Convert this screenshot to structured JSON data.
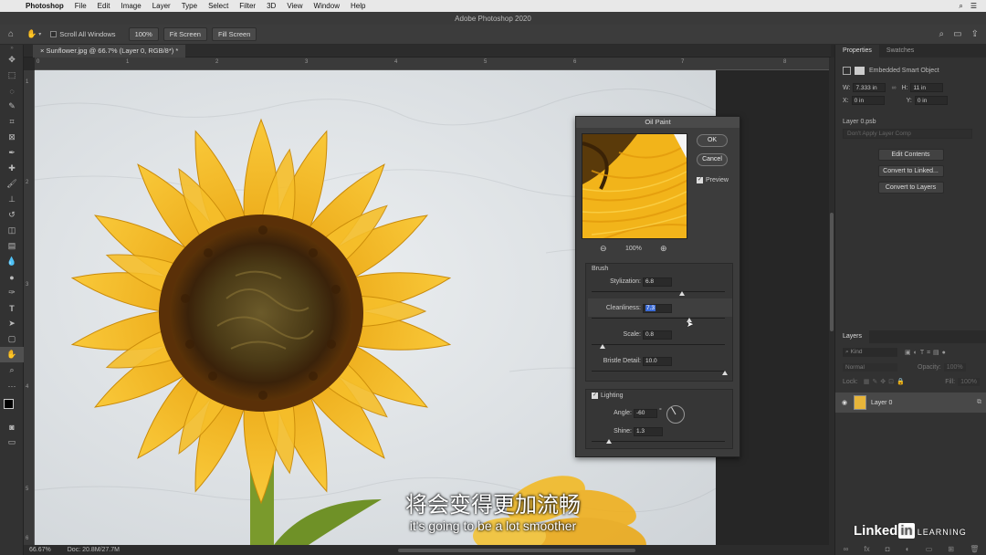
{
  "menubar": {
    "apple": "",
    "app": "Photoshop",
    "items": [
      "File",
      "Edit",
      "Image",
      "Layer",
      "Type",
      "Select",
      "Filter",
      "3D",
      "View",
      "Window",
      "Help"
    ]
  },
  "window": {
    "title": "Adobe Photoshop 2020"
  },
  "options": {
    "scroll_all": "Scroll All Windows",
    "zoom_btn": "100%",
    "fit_btn": "Fit Screen",
    "fill_btn": "Fill Screen"
  },
  "document": {
    "tab": "Sunflower.jpg @ 66.7% (Layer 0, RGB/8*) *",
    "status_zoom": "66.67%",
    "status_doc": "Doc: 20.8M/27.7M"
  },
  "ruler": {
    "h": [
      "0",
      "1",
      "2",
      "3",
      "4",
      "5",
      "6",
      "7",
      "8"
    ],
    "v": [
      "1",
      "2",
      "3",
      "4",
      "5",
      "6"
    ]
  },
  "dialog": {
    "title": "Oil Paint",
    "ok": "OK",
    "cancel": "Cancel",
    "preview": "Preview",
    "zoom": "100%",
    "brush": "Brush",
    "stylization_label": "Stylization:",
    "stylization": "6.8",
    "cleanliness_label": "Cleanliness:",
    "cleanliness": "7.3",
    "scale_label": "Scale:",
    "scale": "0.8",
    "bristle_label": "Bristle Detail:",
    "bristle": "10.0",
    "lighting": "Lighting",
    "angle_label": "Angle:",
    "angle": "-60",
    "angle_unit": "°",
    "shine_label": "Shine:",
    "shine": "1.3",
    "levels": {
      "stylization": 0.68,
      "cleanliness": 0.73,
      "scale": 0.08,
      "bristle": 1.0,
      "shine": 0.13
    }
  },
  "properties": {
    "tab1": "Properties",
    "tab2": "Swatches",
    "type": "Embedded Smart Object",
    "w_label": "W:",
    "w": "7.333 in",
    "h_label": "H:",
    "h": "11 in",
    "x_label": "X:",
    "x": "0 in",
    "y_label": "Y:",
    "y": "0 in",
    "file": "Layer 0.psb",
    "comp": "Don't Apply Layer Comp",
    "edit": "Edit Contents",
    "convert_linked": "Convert to Linked...",
    "convert_layers": "Convert to Layers"
  },
  "layers": {
    "tab": "Layers",
    "kind": "Kind",
    "blend": "Normal",
    "opacity_label": "Opacity:",
    "opacity": "100%",
    "lock_label": "Lock:",
    "fill_label": "Fill:",
    "fill": "100%",
    "layer_name": "Layer 0"
  },
  "subtitles": {
    "zh": "将会变得更加流畅",
    "en": "it's going to be a lot smoother"
  },
  "watermark": {
    "a": "Linked",
    "b": "in",
    "c": "LEARNING"
  },
  "colors": {
    "petal": "#f2b21b",
    "center": "#4a3212",
    "canvas": "#dfe2e4"
  }
}
